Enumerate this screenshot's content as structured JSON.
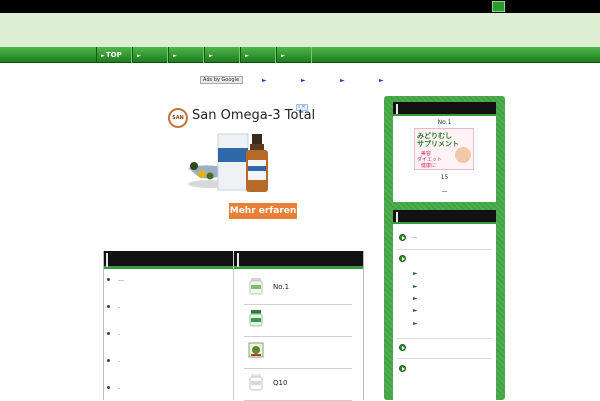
{
  "topbar": {
    "button_icon": "green-square-icon"
  },
  "nav": {
    "items": [
      {
        "label": "TOP"
      },
      {
        "label": ""
      },
      {
        "label": ""
      },
      {
        "label": ""
      },
      {
        "label": ""
      },
      {
        "label": ""
      }
    ],
    "marker": "►"
  },
  "ads_row": {
    "adsby_label": "Ads by Google",
    "links": [
      "►",
      "►",
      "►",
      "►"
    ]
  },
  "ad": {
    "logo_text": "SAN",
    "title": "San Omega-3 Total",
    "cta_label": "Mehr erfaren",
    "close_label": "i ✕",
    "accent_color": "#e8803a"
  },
  "left_list": {
    "items": [
      {
        "text": "…"
      },
      {
        "text": "."
      },
      {
        "text": "."
      },
      {
        "text": "."
      },
      {
        "text": "."
      }
    ]
  },
  "products": [
    {
      "name": "No.1"
    },
    {
      "name": ""
    },
    {
      "name": ""
    },
    {
      "name": "Q10"
    }
  ],
  "sidebar": {
    "card1": {
      "rank_label": "No.1",
      "promo_line1": "みどりむし",
      "promo_line2": "サプリメント",
      "promo_line3": "美容",
      "promo_line4": "ダイエット",
      "promo_line5": "健康に",
      "caption": "15",
      "dash": "—"
    },
    "card2": {
      "rows": [
        {
          "text": "…"
        },
        {
          "text": ""
        }
      ],
      "sub_items": [
        "►",
        "►",
        "►",
        "►",
        "►"
      ],
      "bottom_rows": [
        {
          "text": ""
        },
        {
          "text": ""
        }
      ]
    },
    "color": "#3fa33f"
  }
}
